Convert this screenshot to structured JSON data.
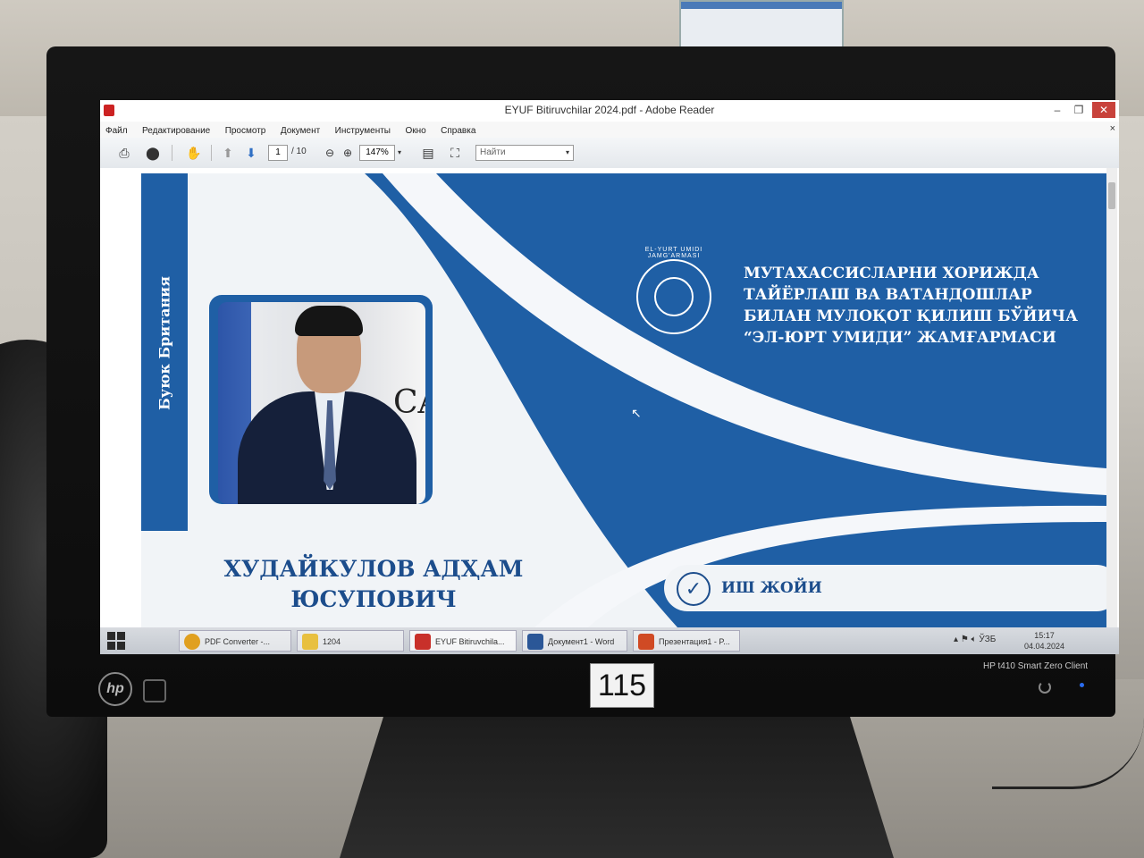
{
  "window": {
    "title": "EYUF Bitiruvchilar 2024.pdf - Adobe Reader",
    "controls": {
      "minimize": "–",
      "maximize": "❐",
      "close": "✕"
    }
  },
  "menu": {
    "items": [
      "Файл",
      "Редактирование",
      "Просмотр",
      "Документ",
      "Инструменты",
      "Окно",
      "Справка"
    ],
    "close": "×"
  },
  "toolbar": {
    "page_current": "1",
    "page_total": "/ 10",
    "zoom": "147%",
    "search_placeholder": "Найти"
  },
  "document": {
    "side_text": "Буюк Британия",
    "person_name_line1": "ХУДАЙКУЛОВ АДҲАМ",
    "person_name_line2": "ЮСУПОВИЧ",
    "photo_sign_text": "CAN",
    "logo_ring_text": "EL-YURT UMIDI JAMG'ARMASI",
    "org_lines": [
      "МУТАХАССИСЛАРНИ ХОРИЖДА",
      "ТАЙЁРЛАШ ВА ВАТАНДОШЛАР",
      "БИЛАН МУЛОҚОТ ҚИЛИШ БЎЙИЧА",
      "“ЭЛ-ЮРТ УМИДИ” ЖАМҒАРМАСИ"
    ],
    "job_label": "ИШ ЖОЙИ"
  },
  "taskbar": {
    "items": [
      {
        "label": "PDF Converter -...",
        "color": "#e0a020"
      },
      {
        "label": "1204",
        "color": "#e8c040"
      },
      {
        "label": "EYUF Bitiruvchila...",
        "color": "#c8302a"
      },
      {
        "label": "Документ1 - Word",
        "color": "#2b5797"
      },
      {
        "label": "Презентация1 - P...",
        "color": "#d04a24"
      }
    ],
    "lang": "ЎЗБ",
    "time": "15:17",
    "date": "04.04.2024"
  },
  "monitor": {
    "brand": "hp",
    "sticker": "115",
    "model": "HP t410 Smart Zero Client"
  }
}
